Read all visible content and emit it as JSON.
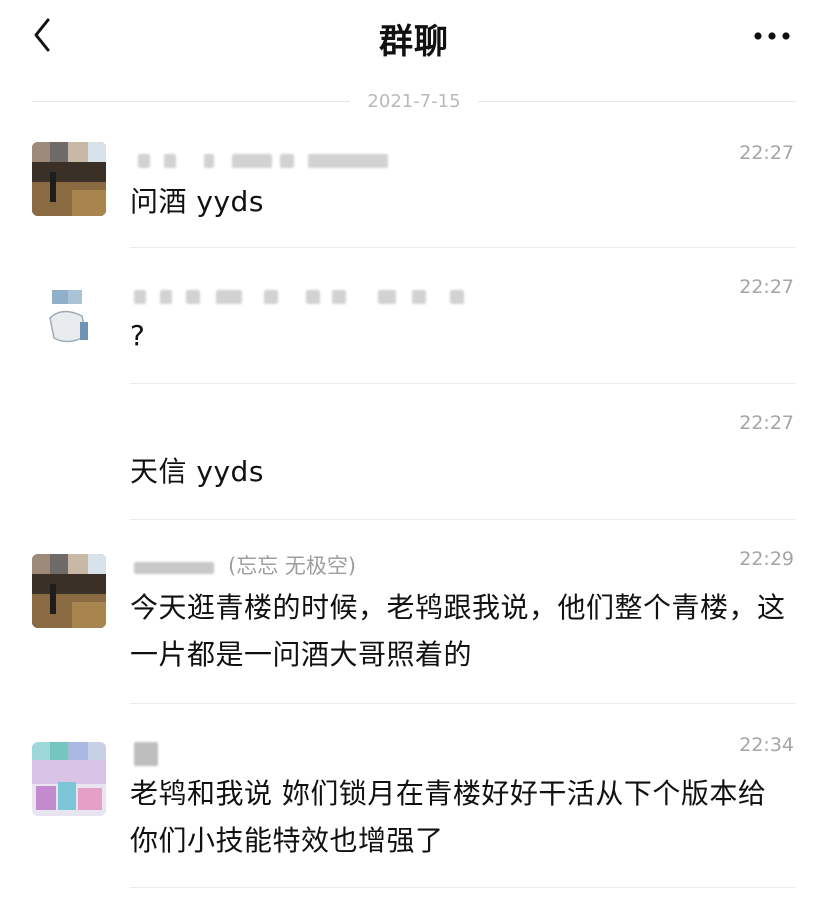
{
  "header": {
    "title": "群聊"
  },
  "date_separator": "2021-7-15",
  "messages": [
    {
      "time": "22:27",
      "sender_visible": "",
      "content": "问酒 yyds"
    },
    {
      "time": "22:27",
      "sender_visible": "",
      "content": "?"
    },
    {
      "time": "22:27",
      "sender_visible": "",
      "content": "天信 yyds"
    },
    {
      "time": "22:29",
      "sender_visible": "(忘忘 无极空)",
      "content": "今天逛青楼的时候，老鸨跟我说，他们整个青楼，这一片都是一问酒大哥照着的"
    },
    {
      "time": "22:34",
      "sender_visible": "",
      "content": "老鸨和我说 妳们锁月在青楼好好干活从下个版本给你们小技能特效也增强了"
    }
  ],
  "icons": {
    "back": "chevron-left-icon",
    "more": "more-dots-icon"
  },
  "colors": {
    "background": "#ffffff",
    "text": "#111111",
    "muted": "#a5a5a5",
    "divider": "#ececec"
  }
}
